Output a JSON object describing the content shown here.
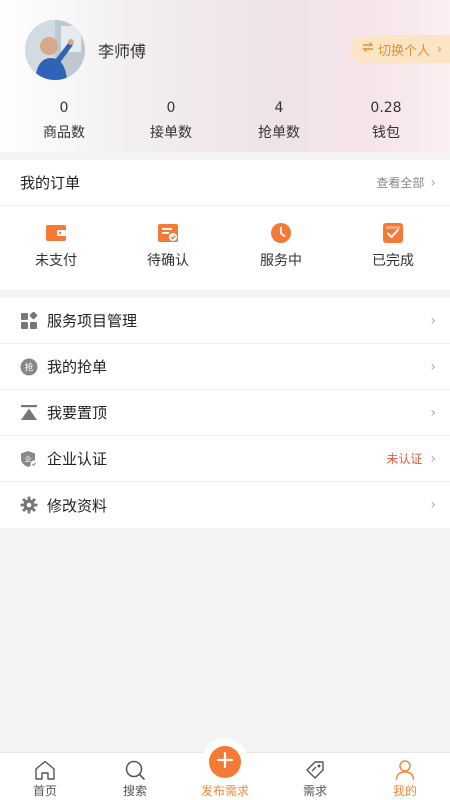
{
  "profile": {
    "name": "李师傅",
    "switch_label": "切换个人",
    "switch_icon": "swap-icon"
  },
  "stats": [
    {
      "value": "0",
      "label": "商品数"
    },
    {
      "value": "0",
      "label": "接单数"
    },
    {
      "value": "4",
      "label": "抢单数"
    },
    {
      "value": "0.28",
      "label": "钱包"
    }
  ],
  "orders": {
    "title": "我的订单",
    "view_all": "查看全部",
    "items": [
      {
        "label": "未支付",
        "icon": "wallet-icon"
      },
      {
        "label": "待确认",
        "icon": "confirm-icon"
      },
      {
        "label": "服务中",
        "icon": "clock-icon"
      },
      {
        "label": "已完成",
        "icon": "check-box-icon"
      }
    ]
  },
  "menu": [
    {
      "label": "服务项目管理",
      "icon": "grid-icon",
      "status": ""
    },
    {
      "label": "我的抢单",
      "icon": "grab-order-icon",
      "icon_text": "抢",
      "status": ""
    },
    {
      "label": "我要置顶",
      "icon": "pin-top-icon",
      "status": ""
    },
    {
      "label": "企业认证",
      "icon": "enterprise-shield-icon",
      "icon_text": "企",
      "status": "未认证"
    },
    {
      "label": "修改资料",
      "icon": "gear-icon",
      "status": ""
    }
  ],
  "tabs": [
    {
      "label": "首页",
      "icon": "home-icon",
      "active": false
    },
    {
      "label": "搜索",
      "icon": "search-icon",
      "active": false
    },
    {
      "label": "发布需求",
      "icon": "plus-icon",
      "active": false
    },
    {
      "label": "需求",
      "icon": "tag-icon",
      "active": false
    },
    {
      "label": "我的",
      "icon": "user-icon",
      "active": true
    }
  ],
  "colors": {
    "accent": "#f47a36",
    "switch_bg": "#fbe5c6",
    "switch_text": "#e8912d",
    "warning_text": "#e55a4a",
    "page_bg": "#f4f4f6"
  }
}
